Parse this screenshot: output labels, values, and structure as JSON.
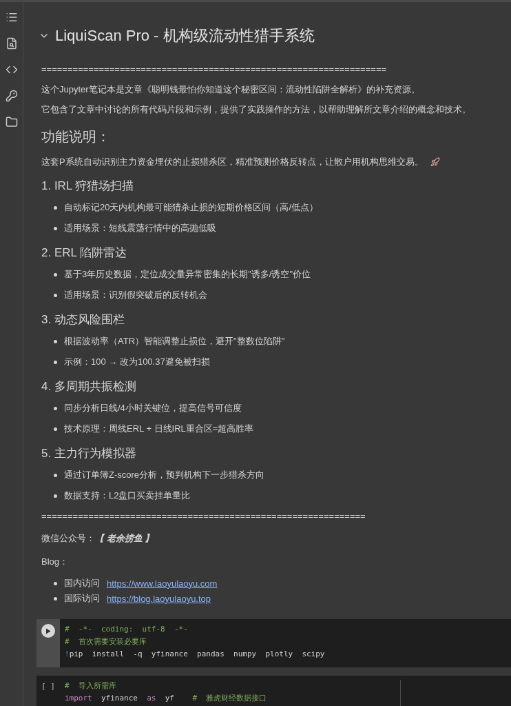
{
  "text_cell": {
    "title": "LiquiScan Pro - 机构级流动性猎手系统",
    "expanded": true,
    "blocks": [
      {
        "kind": "rule",
        "text": "=================================================================="
      },
      {
        "kind": "paragraph",
        "text": "这个Jupyter笔记本是文章《聪明钱最怕你知道这个秘密区间：流动性陷阱全解析》的补充资源。"
      },
      {
        "kind": "paragraph",
        "text": "它包含了文章中讨论的所有代码片段和示例，提供了实践操作的方法，以帮助理解所文章介绍的概念和技术。"
      },
      {
        "kind": "heading",
        "text": "功能说明："
      },
      {
        "kind": "intro",
        "text": "这套P系统自动识别主力资金埋伏的止损猎杀区，精准预测价格反转点，让散户用机构思维交易。"
      },
      {
        "kind": "subheading",
        "text": "1. IRL 狩猎场扫描"
      },
      {
        "kind": "bullets",
        "items": [
          {
            "text": "自动标记20天内机构最可能猎杀止损的短期价格区间（高/低点）"
          },
          {
            "text": "适用场景：短线震荡行情中的高抛低吸"
          }
        ]
      },
      {
        "kind": "subheading",
        "text": "2. ERL 陷阱雷达"
      },
      {
        "kind": "bullets",
        "items": [
          {
            "text": "基于3年历史数据，定位成交量异常密集的长期\"诱多/诱空\"价位"
          },
          {
            "text": "适用场景：识别假突破后的反转机会"
          }
        ]
      },
      {
        "kind": "subheading",
        "text": "3. 动态风险围栏"
      },
      {
        "kind": "bullets",
        "items": [
          {
            "text": "根据波动率（ATR）智能调整止损位，避开\"整数位陷阱\""
          },
          {
            "text": "示例：100 → 改为100.37避免被扫损"
          }
        ]
      },
      {
        "kind": "subheading",
        "text": "4. 多周期共振检测"
      },
      {
        "kind": "bullets",
        "items": [
          {
            "text": "同步分析日线/4小时关键位，提高信号可信度"
          },
          {
            "text": "技术原理：周线ERL + 日线IRL重合区=超高胜率"
          }
        ]
      },
      {
        "kind": "subheading",
        "text": "5. 主力行为模拟器"
      },
      {
        "kind": "bullets",
        "items": [
          {
            "text": "通过订单簿Z-score分析，预判机构下一步猎杀方向"
          },
          {
            "text": "数据支持：L2盘口买卖挂单量比"
          }
        ]
      },
      {
        "kind": "rule",
        "text": "=============================================================="
      },
      {
        "kind": "contact",
        "text": "微信公众号：**【 老余捞鱼 】**"
      },
      {
        "kind": "label",
        "text": "Blog："
      },
      {
        "kind": "links",
        "items": [
          {
            "text": "国内访问",
            "link": "https://www.laoyulaoyu.com"
          },
          {
            "text": "国际访问",
            "link": "https://blog.laoyulaoyu.top"
          }
        ]
      }
    ]
  },
  "code_cells": [
    {
      "kind": "run",
      "lines": [
        [
          {
            "kind": "comment",
            "text": "#  -*-  coding:  utf-8  -*-"
          }
        ],
        [
          {
            "kind": "comment",
            "text": "#  首次需要安装必要库"
          }
        ],
        [
          {
            "kind": "bang",
            "text": "!"
          },
          {
            "kind": "plain",
            "text": "pip  install  -q  yfinance  pandas  numpy  plotly  scipy"
          }
        ]
      ]
    },
    {
      "kind": "label",
      "label": "[ ]",
      "lines": [
        [
          {
            "kind": "comment",
            "text": "#  导入所需库"
          }
        ],
        [
          {
            "kind": "keyword",
            "text": "import"
          },
          {
            "kind": "plain",
            "text": "  yfinance  "
          },
          {
            "kind": "keyword",
            "text": "as"
          },
          {
            "kind": "plain",
            "text": "  yf    "
          },
          {
            "kind": "comment",
            "text": "#  雅虎财经数据接口"
          }
        ]
      ]
    }
  ]
}
